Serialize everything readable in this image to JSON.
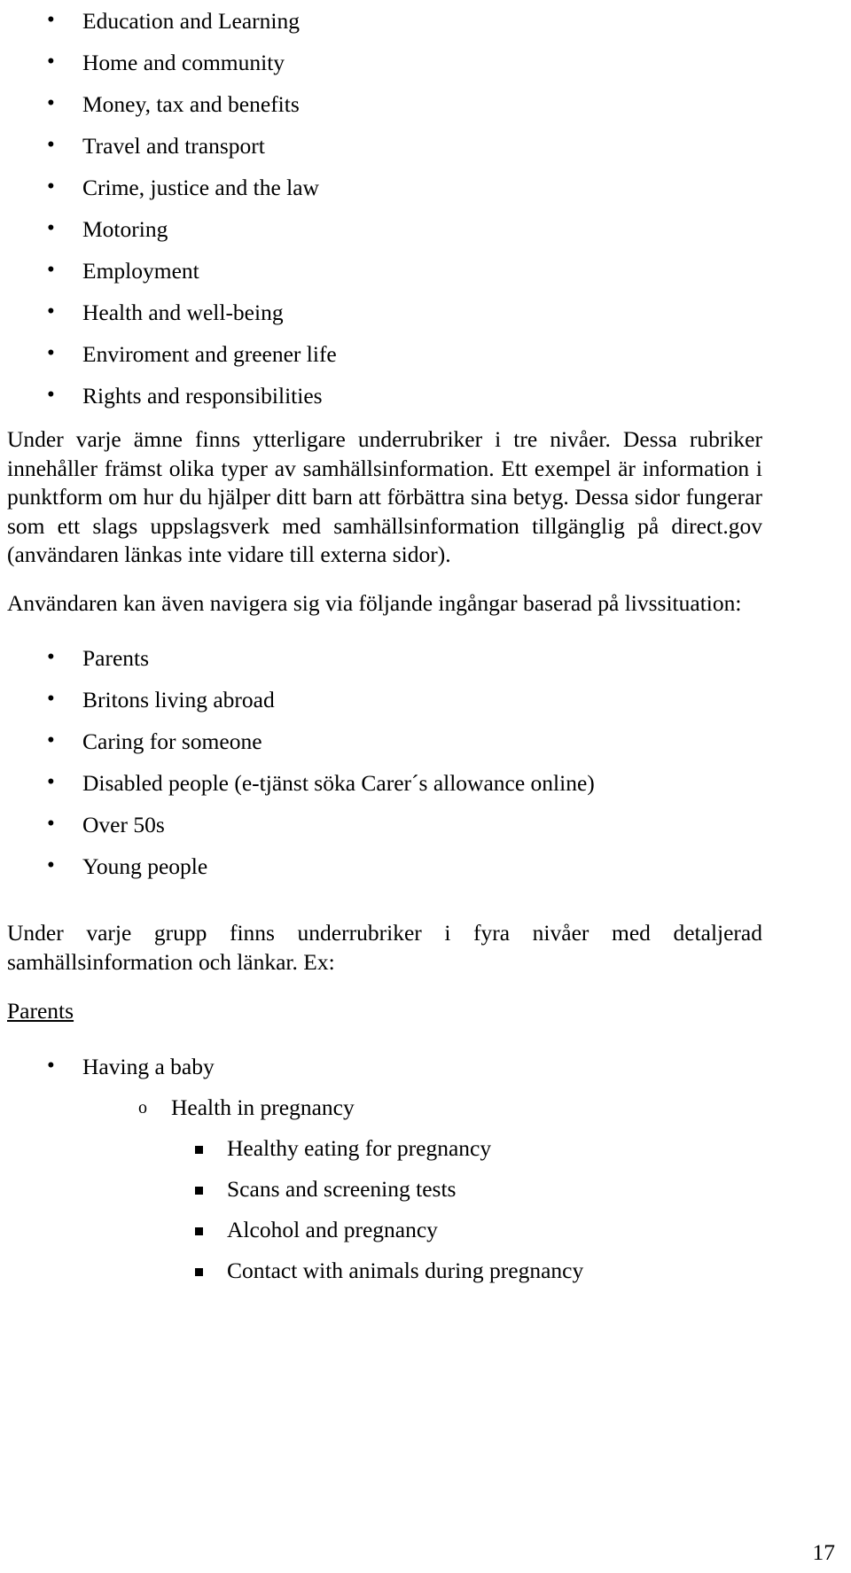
{
  "document": {
    "page_number": "17",
    "topics_list": [
      "Education and Learning",
      "Home and community",
      "Money, tax and benefits",
      "Travel and transport",
      "Crime, justice and the law",
      "Motoring",
      "Employment",
      "Health and well-being",
      "Enviroment and greener life",
      "Rights and responsibilities"
    ],
    "paragraph_1": "Under varje ämne finns ytterligare underrubriker i tre nivåer. Dessa rubriker innehåller främst olika typer av samhällsinformation. Ett exempel är information i punktform om hur du hjälper ditt barn att förbättra sina betyg. Dessa sidor fungerar som ett slags uppslagsverk med samhällsinformation tillgänglig på direct.gov (användaren länkas inte vidare till externa sidor).",
    "paragraph_2": "Användaren kan även navigera sig via följande ingångar baserad på livssituation:",
    "lifesituation_list": [
      "Parents",
      "Britons living abroad",
      "Caring for someone",
      "Disabled people (e-tjänst söka Carer´s allowance online)",
      "Over 50s",
      "Young people"
    ],
    "paragraph_3": "Under varje grupp finns underrubriker i fyra nivåer med detaljerad samhällsinformation och länkar. Ex:",
    "example_heading": "Parents",
    "example_level1": "Having a baby",
    "example_level2": "Health in pregnancy",
    "example_level3": [
      "Healthy eating for pregnancy",
      "Scans and screening tests",
      "Alcohol and pregnancy",
      "Contact with animals during pregnancy"
    ]
  }
}
